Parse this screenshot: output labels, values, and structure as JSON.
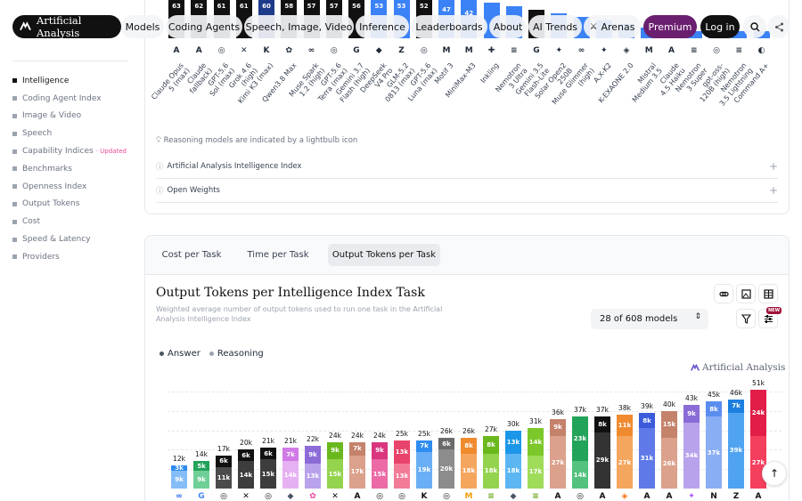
{
  "brand": {
    "name": "Artificial Analysis"
  },
  "nav": {
    "items": [
      "Models",
      "Coding Agents",
      "Speech, Image, Video",
      "Inference",
      "Leaderboards",
      "About",
      "AI Trends"
    ],
    "arenas_label": "Arenas",
    "premium_label": "Premium",
    "login_label": "Log in"
  },
  "sidebar": {
    "items": [
      {
        "label": "Intelligence",
        "active": true
      },
      {
        "label": "Coding Agent Index"
      },
      {
        "label": "Image & Video"
      },
      {
        "label": "Speech"
      },
      {
        "label": "Capability Indices",
        "badge": "· Updated"
      },
      {
        "label": "Benchmarks"
      },
      {
        "label": "Openness Index"
      },
      {
        "label": "Output Tokens"
      },
      {
        "label": "Cost"
      },
      {
        "label": "Speed & Latency"
      },
      {
        "label": "Providers"
      }
    ]
  },
  "top_chart": {
    "note": "Reasoning models are indicated by a lightbulb icon",
    "accordions": [
      "Artificial Analysis Intelligence Index",
      "Open Weights"
    ],
    "models": [
      {
        "label": "Claude Opus\n5 (max)",
        "value": "63",
        "color": "#111111",
        "icon": "A"
      },
      {
        "label": "Claude\nfallback)",
        "value": "62",
        "color": "#111111",
        "icon": "A"
      },
      {
        "label": "GPT-5.6\nSol (max)",
        "value": "61",
        "color": "#111111",
        "icon": "◎"
      },
      {
        "label": "Grok 4.6\n(high)",
        "value": "61",
        "color": "#111111",
        "icon": "✕"
      },
      {
        "label": "Kimi K3 (max)",
        "value": "60",
        "color": "#1e3a8a",
        "icon": "K"
      },
      {
        "label": "Qwen3.8 Max",
        "value": "58",
        "color": "#111111",
        "icon": "✿"
      },
      {
        "label": "Muse Spark\n1.2 (high)",
        "value": "57",
        "color": "#111111",
        "icon": "∞"
      },
      {
        "label": "GPT-5.6\nTerra (max)",
        "value": "57",
        "color": "#111111",
        "icon": "◎"
      },
      {
        "label": "Gemini 3.7\nFlash (high)",
        "value": "56",
        "color": "#111111",
        "icon": "G"
      },
      {
        "label": "DeepSeek\nV4 Pro",
        "value": "53",
        "color": "#3b82f6",
        "icon": "◆"
      },
      {
        "label": "GLM-5.2\n0813 (max)",
        "value": "53",
        "color": "#3b82f6",
        "icon": "Z"
      },
      {
        "label": "GPT-5.6\nLuna (max)",
        "value": "52",
        "color": "#111111",
        "icon": "◎"
      },
      {
        "label": "Motif 3",
        "value": "47",
        "color": "#3b82f6",
        "icon": "M"
      },
      {
        "label": "MiniMax-M3",
        "value": "42",
        "color": "#3b82f6",
        "icon": "M"
      },
      {
        "label": "Inkling",
        "value": "",
        "color": "#3b82f6",
        "icon": "✚"
      },
      {
        "label": "Nemotron\n3 Ultra",
        "value": "",
        "color": "#3b82f6",
        "icon": "≡"
      },
      {
        "label": "Gemini 3.5\nFlash-Lite",
        "value": "",
        "color": "#111111",
        "icon": "G"
      },
      {
        "label": "Solar Open2\n250B",
        "value": "",
        "color": "#3b82f6",
        "icon": "✦"
      },
      {
        "label": "Muse Glimmer\n(high)",
        "value": "",
        "color": "#3b82f6",
        "icon": "∞"
      },
      {
        "label": "A.X-K2",
        "value": "",
        "color": "#3b82f6",
        "icon": "✦"
      },
      {
        "label": "K-EXAONE 2.0",
        "value": "",
        "color": "#3b82f6",
        "icon": "◈"
      },
      {
        "label": "Mistral\nMedium 3.5",
        "value": "",
        "color": "#3b82f6",
        "icon": "M"
      },
      {
        "label": "Claude\n4.5 Haiku",
        "value": "",
        "color": "#3b82f6",
        "icon": "A"
      },
      {
        "label": "Nemotron\n3 Super",
        "value": "",
        "color": "#3b82f6",
        "icon": "≡"
      },
      {
        "label": "gpt-oss-\n120B (high)",
        "value": "",
        "color": "#3b82f6",
        "icon": "◎"
      },
      {
        "label": "Nemotron\n3.5 Lightning",
        "value": "",
        "color": "#3b82f6",
        "icon": "≡"
      },
      {
        "label": "Command A+",
        "value": "",
        "color": "#3b82f6",
        "icon": "◐"
      }
    ]
  },
  "tabs": [
    {
      "label": "Cost per Task"
    },
    {
      "label": "Time per Task"
    },
    {
      "label": "Output Tokens per Task",
      "active": true
    }
  ],
  "chart": {
    "title": "Output Tokens per Intelligence Index Task",
    "subtitle": "Weighted average number of output tokens used to run one task in the Artificial Analysis Intelligence Index",
    "models_selector": "28 of 608 models",
    "new_badge": "NEW",
    "watermark": "Artificial Analysis",
    "legend": [
      {
        "label": "Answer",
        "color": "#4b5563"
      },
      {
        "label": "Reasoning",
        "color": "#9ca3af"
      }
    ]
  },
  "chart_data": {
    "type": "bar",
    "stacked": true,
    "series_names": [
      "Answer",
      "Reasoning"
    ],
    "ylim": [
      0,
      51000
    ],
    "bars": [
      {
        "total": "12k",
        "answer": "3k",
        "reasoning": "9k",
        "answer_value": 3,
        "reasoning_value": 9,
        "answer_color": "#2f8cf0",
        "reasoning_color": "#84bdf7",
        "icon": "∞",
        "icon_color": "#2563eb"
      },
      {
        "total": "14k",
        "answer": "5k",
        "reasoning": "9k",
        "answer_value": 5,
        "reasoning_value": 9,
        "answer_color": "#22a35a",
        "reasoning_color": "#6fcf97",
        "icon": "G",
        "icon_color": "#4285f4"
      },
      {
        "total": "17k",
        "answer": "6k",
        "reasoning": "11k",
        "answer_value": 6,
        "reasoning_value": 11,
        "answer_color": "#111111",
        "reasoning_color": "#4b4b4b",
        "icon": "◎",
        "icon_color": "#111"
      },
      {
        "total": "20k",
        "answer": "6k",
        "reasoning": "14k",
        "answer_value": 6,
        "reasoning_value": 14,
        "answer_color": "#111111",
        "reasoning_color": "#3d3d3d",
        "icon": "✕",
        "icon_color": "#111"
      },
      {
        "total": "21k",
        "answer": "6k",
        "reasoning": "15k",
        "answer_value": 6,
        "reasoning_value": 15,
        "answer_color": "#111111",
        "reasoning_color": "#3d3d3d",
        "icon": "◎",
        "icon_color": "#111"
      },
      {
        "total": "21k",
        "answer": "7k",
        "reasoning": "14k",
        "answer_value": 7,
        "reasoning_value": 14,
        "answer_color": "#d07ae6",
        "reasoning_color": "#e6b1f2",
        "icon": "◆",
        "icon_color": "#4b5563"
      },
      {
        "total": "22k",
        "answer": "9k",
        "reasoning": "13k",
        "answer_value": 9,
        "reasoning_value": 13,
        "answer_color": "#8b6bd6",
        "reasoning_color": "#b8a2ec",
        "icon": "✿",
        "icon_color": "#ec4899"
      },
      {
        "total": "24k",
        "answer": "9k",
        "reasoning": "15k",
        "answer_value": 9,
        "reasoning_value": 15,
        "answer_color": "#6ab81d",
        "reasoning_color": "#94d34d",
        "icon": "✕",
        "icon_color": "#111"
      },
      {
        "total": "24k",
        "answer": "7k",
        "reasoning": "17k",
        "answer_value": 7,
        "reasoning_value": 17,
        "answer_color": "#c4826b",
        "reasoning_color": "#dba18c",
        "icon": "A",
        "icon_color": "#111"
      },
      {
        "total": "24k",
        "answer": "9k",
        "reasoning": "15k",
        "answer_value": 9,
        "reasoning_value": 15,
        "answer_color": "#d9367e",
        "reasoning_color": "#ec6aa5",
        "icon": "◎",
        "icon_color": "#111"
      },
      {
        "total": "25k",
        "answer": "13k",
        "reasoning": "13k",
        "answer_value": 12,
        "reasoning_value": 13,
        "answer_color": "#e8436a",
        "reasoning_color": "#f27b98",
        "icon": "◎",
        "icon_color": "#111"
      },
      {
        "total": "25k",
        "answer": "7k",
        "reasoning": "19k",
        "answer_value": 6,
        "reasoning_value": 19,
        "answer_color": "#2f8cf0",
        "reasoning_color": "#6aaff5",
        "icon": "K",
        "icon_color": "#111"
      },
      {
        "total": "26k",
        "answer": "6k",
        "reasoning": "20k",
        "answer_value": 6,
        "reasoning_value": 20,
        "answer_color": "#6b6b6b",
        "reasoning_color": "#8c8c8c",
        "icon": "◎",
        "icon_color": "#111"
      },
      {
        "total": "26k",
        "answer": "8k",
        "reasoning": "18k",
        "answer_value": 8,
        "reasoning_value": 18,
        "answer_color": "#f08a2f",
        "reasoning_color": "#f5a65e",
        "icon": "M",
        "icon_color": "#f59e0b"
      },
      {
        "total": "27k",
        "answer": "8k",
        "reasoning": "18k",
        "answer_value": 9,
        "reasoning_value": 18,
        "answer_color": "#6ab81d",
        "reasoning_color": "#94d34d",
        "icon": "≡",
        "icon_color": "#65a30d"
      },
      {
        "total": "30k",
        "answer": "13k",
        "reasoning": "18k",
        "answer_value": 12,
        "reasoning_value": 18,
        "answer_color": "#1c97e8",
        "reasoning_color": "#5cb6f2",
        "icon": "◆",
        "icon_color": "#4b5563"
      },
      {
        "total": "31k",
        "answer": "14k",
        "reasoning": "17k",
        "answer_value": 14,
        "reasoning_value": 17,
        "answer_color": "#7cc72a",
        "reasoning_color": "#9fdc5a",
        "icon": "≡",
        "icon_color": "#65a30d"
      },
      {
        "total": "36k",
        "answer": "9k",
        "reasoning": "27k",
        "answer_value": 9,
        "reasoning_value": 27,
        "answer_color": "#c4826b",
        "reasoning_color": "#dba18c",
        "icon": "A",
        "icon_color": "#111"
      },
      {
        "total": "37k",
        "answer": "23k",
        "reasoning": "14k",
        "answer_value": 23,
        "reasoning_value": 14,
        "answer_color": "#22a35a",
        "reasoning_color": "#52c27e",
        "icon": "◎",
        "icon_color": "#111"
      },
      {
        "total": "37k",
        "answer": "8k",
        "reasoning": "29k",
        "answer_value": 8,
        "reasoning_value": 29,
        "answer_color": "#111111",
        "reasoning_color": "#333333",
        "icon": "A",
        "icon_color": "#111"
      },
      {
        "total": "38k",
        "answer": "11k",
        "reasoning": "27k",
        "answer_value": 11,
        "reasoning_value": 27,
        "answer_color": "#f08a2f",
        "reasoning_color": "#f5a65e",
        "icon": "◈",
        "icon_color": "#f97316"
      },
      {
        "total": "39k",
        "answer": "8k",
        "reasoning": "31k",
        "answer_value": 8,
        "reasoning_value": 31,
        "answer_color": "#3b5bdb",
        "reasoning_color": "#5f7ae8",
        "icon": "A",
        "icon_color": "#111"
      },
      {
        "total": "40k",
        "answer": "15k",
        "reasoning": "26k",
        "answer_value": 14,
        "reasoning_value": 26,
        "answer_color": "#c4826b",
        "reasoning_color": "#dba18c",
        "icon": "A",
        "icon_color": "#111"
      },
      {
        "total": "43k",
        "answer": "9k",
        "reasoning": "34k",
        "answer_value": 9,
        "reasoning_value": 34,
        "answer_color": "#8b6bd6",
        "reasoning_color": "#b8a2ec",
        "icon": "✦",
        "icon_color": "#a855f7"
      },
      {
        "total": "45k",
        "answer": "8k",
        "reasoning": "37k",
        "answer_value": 8,
        "reasoning_value": 37,
        "answer_color": "#5b8def",
        "reasoning_color": "#8aaef4",
        "icon": "N",
        "icon_color": "#111"
      },
      {
        "total": "46k",
        "answer": "7k",
        "reasoning": "39k",
        "answer_value": 7,
        "reasoning_value": 39,
        "answer_color": "#1c7fe0",
        "reasoning_color": "#4fa3f0",
        "icon": "Z",
        "icon_color": "#111"
      },
      {
        "total": "51k",
        "answer": "24k",
        "reasoning": "27k",
        "answer_value": 24,
        "reasoning_value": 27,
        "answer_color": "#e11d48",
        "reasoning_color": "#f43f5e",
        "icon": "A",
        "icon_color": "#111"
      }
    ]
  }
}
